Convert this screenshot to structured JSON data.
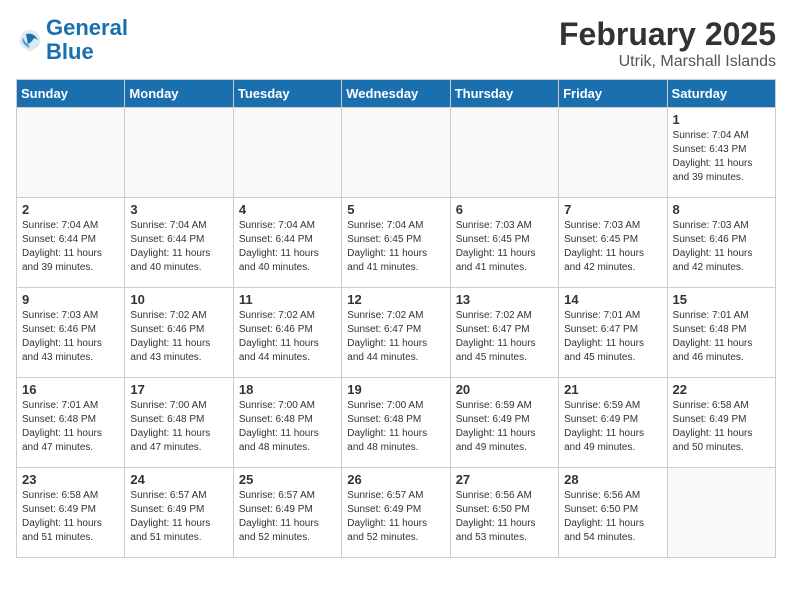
{
  "logo": {
    "line1": "General",
    "line2": "Blue"
  },
  "title": "February 2025",
  "location": "Utrik, Marshall Islands",
  "weekdays": [
    "Sunday",
    "Monday",
    "Tuesday",
    "Wednesday",
    "Thursday",
    "Friday",
    "Saturday"
  ],
  "weeks": [
    [
      {
        "day": "",
        "info": ""
      },
      {
        "day": "",
        "info": ""
      },
      {
        "day": "",
        "info": ""
      },
      {
        "day": "",
        "info": ""
      },
      {
        "day": "",
        "info": ""
      },
      {
        "day": "",
        "info": ""
      },
      {
        "day": "1",
        "info": "Sunrise: 7:04 AM\nSunset: 6:43 PM\nDaylight: 11 hours and 39 minutes."
      }
    ],
    [
      {
        "day": "2",
        "info": "Sunrise: 7:04 AM\nSunset: 6:44 PM\nDaylight: 11 hours and 39 minutes."
      },
      {
        "day": "3",
        "info": "Sunrise: 7:04 AM\nSunset: 6:44 PM\nDaylight: 11 hours and 40 minutes."
      },
      {
        "day": "4",
        "info": "Sunrise: 7:04 AM\nSunset: 6:44 PM\nDaylight: 11 hours and 40 minutes."
      },
      {
        "day": "5",
        "info": "Sunrise: 7:04 AM\nSunset: 6:45 PM\nDaylight: 11 hours and 41 minutes."
      },
      {
        "day": "6",
        "info": "Sunrise: 7:03 AM\nSunset: 6:45 PM\nDaylight: 11 hours and 41 minutes."
      },
      {
        "day": "7",
        "info": "Sunrise: 7:03 AM\nSunset: 6:45 PM\nDaylight: 11 hours and 42 minutes."
      },
      {
        "day": "8",
        "info": "Sunrise: 7:03 AM\nSunset: 6:46 PM\nDaylight: 11 hours and 42 minutes."
      }
    ],
    [
      {
        "day": "9",
        "info": "Sunrise: 7:03 AM\nSunset: 6:46 PM\nDaylight: 11 hours and 43 minutes."
      },
      {
        "day": "10",
        "info": "Sunrise: 7:02 AM\nSunset: 6:46 PM\nDaylight: 11 hours and 43 minutes."
      },
      {
        "day": "11",
        "info": "Sunrise: 7:02 AM\nSunset: 6:46 PM\nDaylight: 11 hours and 44 minutes."
      },
      {
        "day": "12",
        "info": "Sunrise: 7:02 AM\nSunset: 6:47 PM\nDaylight: 11 hours and 44 minutes."
      },
      {
        "day": "13",
        "info": "Sunrise: 7:02 AM\nSunset: 6:47 PM\nDaylight: 11 hours and 45 minutes."
      },
      {
        "day": "14",
        "info": "Sunrise: 7:01 AM\nSunset: 6:47 PM\nDaylight: 11 hours and 45 minutes."
      },
      {
        "day": "15",
        "info": "Sunrise: 7:01 AM\nSunset: 6:48 PM\nDaylight: 11 hours and 46 minutes."
      }
    ],
    [
      {
        "day": "16",
        "info": "Sunrise: 7:01 AM\nSunset: 6:48 PM\nDaylight: 11 hours and 47 minutes."
      },
      {
        "day": "17",
        "info": "Sunrise: 7:00 AM\nSunset: 6:48 PM\nDaylight: 11 hours and 47 minutes."
      },
      {
        "day": "18",
        "info": "Sunrise: 7:00 AM\nSunset: 6:48 PM\nDaylight: 11 hours and 48 minutes."
      },
      {
        "day": "19",
        "info": "Sunrise: 7:00 AM\nSunset: 6:48 PM\nDaylight: 11 hours and 48 minutes."
      },
      {
        "day": "20",
        "info": "Sunrise: 6:59 AM\nSunset: 6:49 PM\nDaylight: 11 hours and 49 minutes."
      },
      {
        "day": "21",
        "info": "Sunrise: 6:59 AM\nSunset: 6:49 PM\nDaylight: 11 hours and 49 minutes."
      },
      {
        "day": "22",
        "info": "Sunrise: 6:58 AM\nSunset: 6:49 PM\nDaylight: 11 hours and 50 minutes."
      }
    ],
    [
      {
        "day": "23",
        "info": "Sunrise: 6:58 AM\nSunset: 6:49 PM\nDaylight: 11 hours and 51 minutes."
      },
      {
        "day": "24",
        "info": "Sunrise: 6:57 AM\nSunset: 6:49 PM\nDaylight: 11 hours and 51 minutes."
      },
      {
        "day": "25",
        "info": "Sunrise: 6:57 AM\nSunset: 6:49 PM\nDaylight: 11 hours and 52 minutes."
      },
      {
        "day": "26",
        "info": "Sunrise: 6:57 AM\nSunset: 6:49 PM\nDaylight: 11 hours and 52 minutes."
      },
      {
        "day": "27",
        "info": "Sunrise: 6:56 AM\nSunset: 6:50 PM\nDaylight: 11 hours and 53 minutes."
      },
      {
        "day": "28",
        "info": "Sunrise: 6:56 AM\nSunset: 6:50 PM\nDaylight: 11 hours and 54 minutes."
      },
      {
        "day": "",
        "info": ""
      }
    ]
  ]
}
